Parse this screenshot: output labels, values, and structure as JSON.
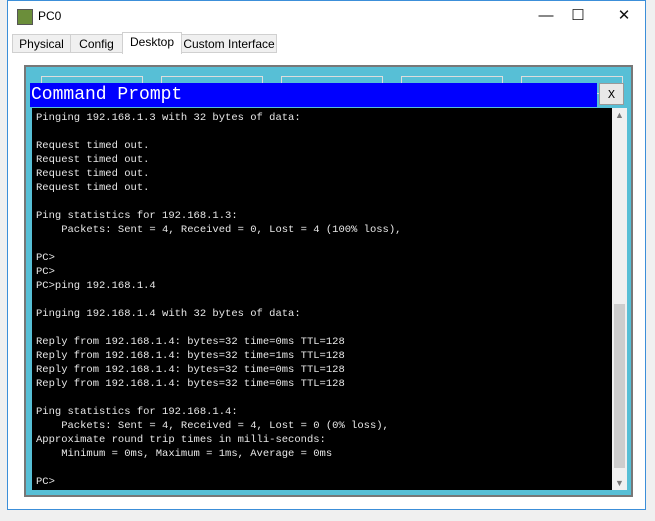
{
  "window": {
    "title": "PC0",
    "minimize": "—",
    "maximize": "☐",
    "close": "✕"
  },
  "tabs": [
    {
      "label": "Physical"
    },
    {
      "label": "Config"
    },
    {
      "label": "Desktop",
      "active": true
    },
    {
      "label": "Custom Interface"
    }
  ],
  "command_prompt": {
    "title": "Command Prompt",
    "close_label": "X",
    "lines": [
      "Pinging 192.168.1.3 with 32 bytes of data:",
      "",
      "Request timed out.",
      "Request timed out.",
      "Request timed out.",
      "Request timed out.",
      "",
      "Ping statistics for 192.168.1.3:",
      "    Packets: Sent = 4, Received = 0, Lost = 4 (100% loss),",
      "",
      "PC>",
      "PC>",
      "PC>ping 192.168.1.4",
      "",
      "Pinging 192.168.1.4 with 32 bytes of data:",
      "",
      "Reply from 192.168.1.4: bytes=32 time=0ms TTL=128",
      "Reply from 192.168.1.4: bytes=32 time=1ms TTL=128",
      "Reply from 192.168.1.4: bytes=32 time=0ms TTL=128",
      "Reply from 192.168.1.4: bytes=32 time=0ms TTL=128",
      "",
      "Ping statistics for 192.168.1.4:",
      "    Packets: Sent = 4, Received = 4, Lost = 0 (0% loss),",
      "Approximate round trip times in milli-seconds:",
      "    Minimum = 0ms, Maximum = 1ms, Average = 0ms",
      "",
      "PC>"
    ]
  },
  "colors": {
    "title_bar": "#0000ff",
    "desktop_bg": "#57bfd6",
    "terminal_bg": "#000000"
  }
}
